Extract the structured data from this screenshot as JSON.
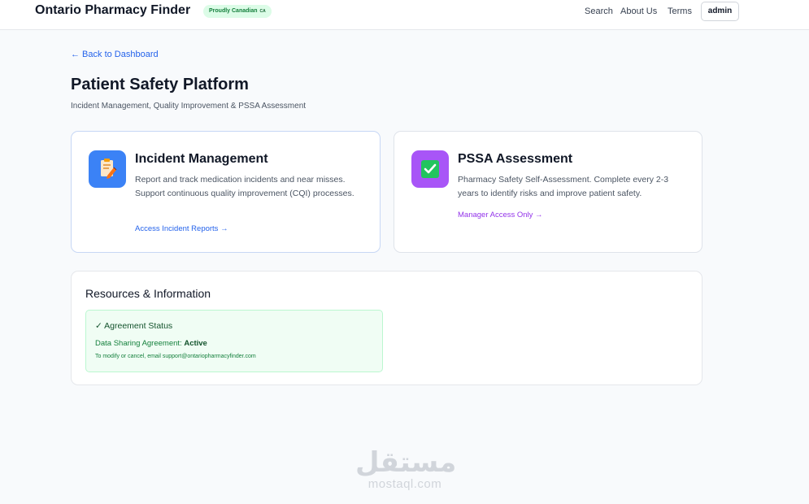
{
  "header": {
    "brand": "Ontario Pharmacy Finder",
    "badge_text": "Proudly Canadian",
    "badge_flag": "CA",
    "nav": {
      "search": "Search",
      "about": "About Us",
      "terms": "Terms"
    },
    "user_button": "admin"
  },
  "main": {
    "back_link": "← Back to Dashboard",
    "title": "Patient Safety Platform",
    "subtitle": "Incident Management, Quality Improvement & PSSA Assessment"
  },
  "cards": {
    "incident": {
      "icon": "clipboard-pencil-icon",
      "title": "Incident Management",
      "description": "Report and track medication incidents and near misses. Support continuous quality improvement (CQI) processes.",
      "link": "Access Incident Reports →"
    },
    "pssa": {
      "icon": "checkbox-icon",
      "title": "PSSA Assessment",
      "description": "Pharmacy Safety Self-Assessment. Complete every 2-3 years to identify risks and improve patient safety.",
      "link": "Manager Access Only →"
    }
  },
  "resources": {
    "title": "Resources & Information",
    "agreement": {
      "title": "✓ Agreement Status",
      "label": "Data Sharing Agreement: ",
      "status": "Active",
      "note": "To modify or cancel, email support@ontariopharmacyfinder.com"
    }
  },
  "watermark": {
    "arabic": "مستقل",
    "latin": "mostaql.com"
  },
  "colors": {
    "accent_blue": "#2563eb",
    "accent_purple": "#9333ea",
    "success_green": "#15803d"
  }
}
